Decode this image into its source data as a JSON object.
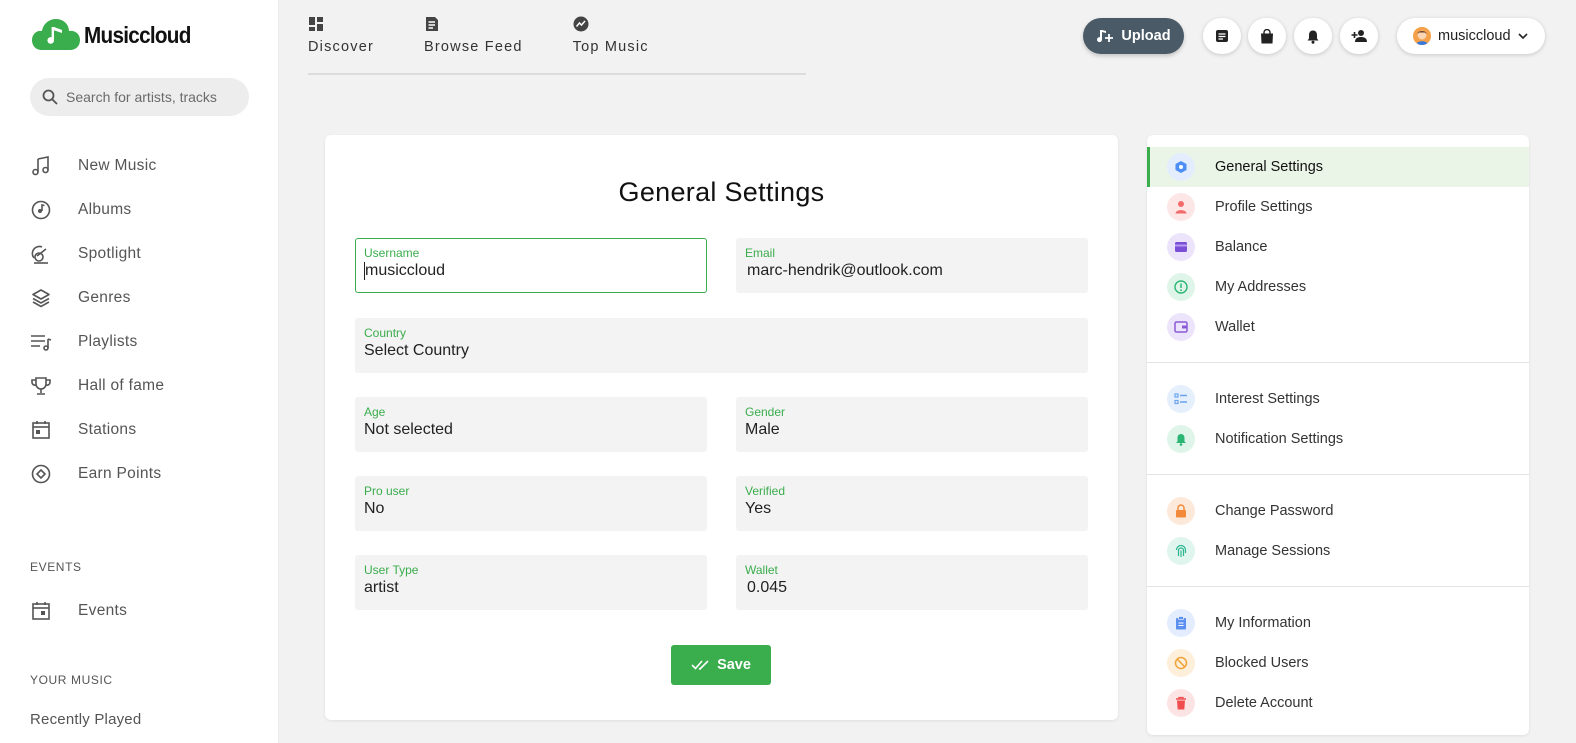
{
  "app": {
    "name": "Musiccloud",
    "search_placeholder": "Search for artists, tracks"
  },
  "sidebar": {
    "items": [
      {
        "label": "New Music",
        "icon": "music-notes-icon"
      },
      {
        "label": "Albums",
        "icon": "album-disc-icon"
      },
      {
        "label": "Spotlight",
        "icon": "spotlight-icon"
      },
      {
        "label": "Genres",
        "icon": "layers-icon"
      },
      {
        "label": "Playlists",
        "icon": "playlist-icon"
      },
      {
        "label": "Hall of fame",
        "icon": "trophy-icon"
      },
      {
        "label": "Stations",
        "icon": "stations-icon"
      },
      {
        "label": "Earn Points",
        "icon": "target-icon"
      }
    ],
    "events_title": "EVENTS",
    "events_label": "Events",
    "your_music_title": "YOUR MUSIC",
    "recently_played": "Recently Played"
  },
  "tabs": [
    {
      "label": "Discover",
      "icon": "dashboard-icon"
    },
    {
      "label": "Browse Feed",
      "icon": "feed-icon"
    },
    {
      "label": "Top Music",
      "icon": "trending-icon"
    }
  ],
  "header": {
    "upload_label": "Upload",
    "username": "musiccloud"
  },
  "settings": {
    "title": "General Settings",
    "fields": {
      "username": {
        "label": "Username",
        "value": "musiccloud"
      },
      "email": {
        "label": "Email",
        "value": "marc-hendrik@outlook.com"
      },
      "country": {
        "label": "Country",
        "value": "Select Country"
      },
      "age": {
        "label": "Age",
        "value": "Not selected"
      },
      "gender": {
        "label": "Gender",
        "value": "Male"
      },
      "pro_user": {
        "label": "Pro user",
        "value": "No"
      },
      "verified": {
        "label": "Verified",
        "value": "Yes"
      },
      "user_type": {
        "label": "User Type",
        "value": "artist"
      },
      "wallet": {
        "label": "Wallet",
        "value": "0.045"
      }
    },
    "save_label": "Save"
  },
  "menu": {
    "groups": [
      [
        {
          "label": "General Settings",
          "icon": "hexagon-icon",
          "color": "#4d8ff5",
          "bg": "#e3edfd"
        },
        {
          "label": "Profile Settings",
          "icon": "person-icon",
          "color": "#f26b6b",
          "bg": "#fde6e6"
        },
        {
          "label": "Balance",
          "icon": "card-icon",
          "color": "#7a4fd6",
          "bg": "#ece4fa"
        },
        {
          "label": "My Addresses",
          "icon": "alert-circle-icon",
          "color": "#2bb673",
          "bg": "#dff5ea"
        },
        {
          "label": "Wallet",
          "icon": "wallet-icon",
          "color": "#8a5ad6",
          "bg": "#ece4fa"
        }
      ],
      [
        {
          "label": "Interest Settings",
          "icon": "checklist-icon",
          "color": "#6aa4f0",
          "bg": "#e6effc"
        },
        {
          "label": "Notification Settings",
          "icon": "bell-icon",
          "color": "#2bb673",
          "bg": "#dff5ea"
        }
      ],
      [
        {
          "label": "Change Password",
          "icon": "lock-icon",
          "color": "#f28a3a",
          "bg": "#fde9da"
        },
        {
          "label": "Manage Sessions",
          "icon": "fingerprint-icon",
          "color": "#2bb68f",
          "bg": "#dff5ee"
        }
      ],
      [
        {
          "label": "My Information",
          "icon": "clipboard-icon",
          "color": "#5b8ff0",
          "bg": "#e3edfd"
        },
        {
          "label": "Blocked Users",
          "icon": "block-icon",
          "color": "#f2a23a",
          "bg": "#fdefd9"
        },
        {
          "label": "Delete Account",
          "icon": "trash-icon",
          "color": "#f04e4e",
          "bg": "#fde4e4"
        }
      ]
    ]
  },
  "colors": {
    "accent": "#3aad4d",
    "upload_button": "#4a5b67"
  }
}
